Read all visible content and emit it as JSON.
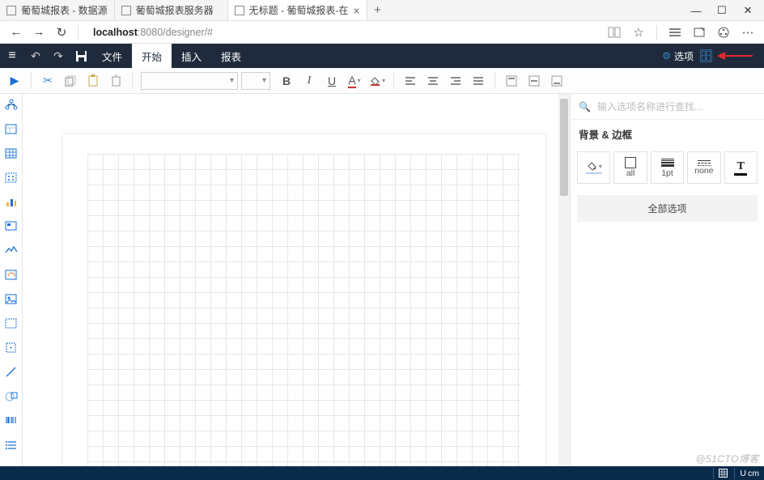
{
  "browser": {
    "tabs": [
      {
        "label": "葡萄城报表 - 数据源"
      },
      {
        "label": "葡萄城报表服务器"
      },
      {
        "label": "无标题 - 葡萄城报表-在"
      }
    ],
    "url_host": "localhost",
    "url_port_path": ":8080/designer/#"
  },
  "app": {
    "menu": {
      "file": "文件",
      "start": "开始",
      "insert": "插入",
      "report": "报表"
    },
    "options_label": "选项"
  },
  "search": {
    "placeholder": "输入选项名称进行查找..."
  },
  "panel": {
    "section_title": "背景 & 边框",
    "all": "all",
    "weight": "1pt",
    "style": "none",
    "all_options": "全部选项"
  },
  "status": {
    "unit_label": "U",
    "unit_value": "cm"
  },
  "watermark": "@51CTO博客"
}
